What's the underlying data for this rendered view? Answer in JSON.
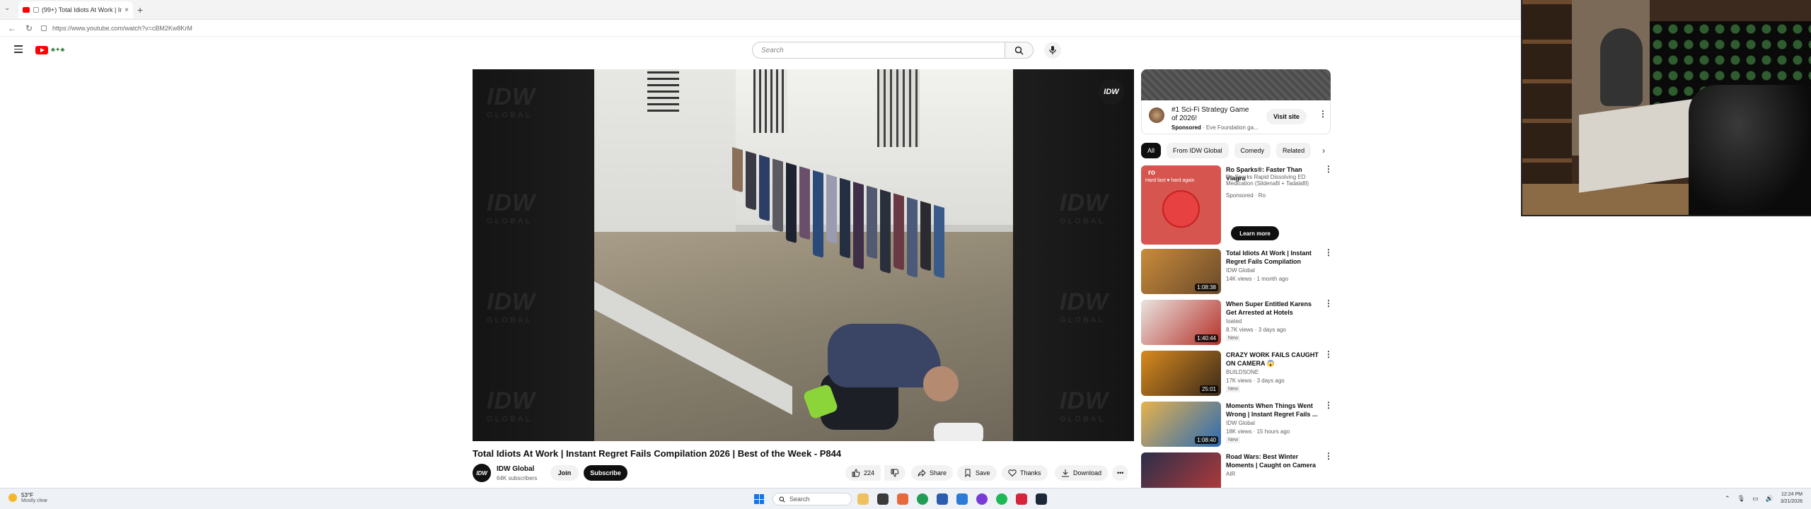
{
  "browser": {
    "tab_title": "(99+) Total Idiots At Work | In...",
    "tab_close": "×",
    "new_tab": "+",
    "url": "https://www.youtube.com/watch?v=cBM2Kw8KrM"
  },
  "header": {
    "search_placeholder": "Search"
  },
  "player": {
    "watermark": "IDW",
    "watermark_sub": "GLOBAL",
    "badge": "IDW"
  },
  "video": {
    "title": "Total Idiots At Work | Instant Regret Fails Compilation 2026 | Best of the Week - P844",
    "channel_name": "IDW Global",
    "channel_avatar": "IDW",
    "subscribers": "64K subscribers",
    "join_label": "Join",
    "subscribe_label": "Subscribe",
    "likes": "224",
    "share_label": "Share",
    "save_label": "Save",
    "thanks_label": "Thanks",
    "download_label": "Download",
    "more_label": "•••"
  },
  "sidebar": {
    "ad": {
      "title": "#1 Sci-Fi Strategy Game of 2026!",
      "sponsored": "Sponsored",
      "advertiser": "· Eve Foundation ga...",
      "visit_label": "Visit site"
    },
    "chips": [
      "All",
      "From IDW Global",
      "Comedy",
      "Related"
    ],
    "chip_next": "›",
    "recommendations": [
      {
        "title": "Ro Sparks®: Faster Than Viagra",
        "line2": "Ro Sparks Rapid Dissolving ED Medication (Sildenafil + Tadalafil)",
        "line3": "Sponsored · Ro",
        "is_ad": true,
        "cta": "Learn more",
        "thumb_text": "ro",
        "thumb_sub": "Hard fast ♥ hard again",
        "thumb_colors": [
          "#d7554f"
        ]
      },
      {
        "title": "Total Idiots At Work | Instant Regret Fails Compilation 2026...",
        "channel": "IDW Global",
        "views": "14K views · 1 month ago",
        "duration": "1:08:38",
        "badge": "",
        "thumb_colors": [
          "#c98b3a",
          "#6a4a2a"
        ]
      },
      {
        "title": "When Super Entitled Karens Get Arrested at Hotels",
        "channel": "Ioated",
        "views": "8.7K views · 3 days ago",
        "duration": "1:40:44",
        "badge": "New",
        "thumb_colors": [
          "#e9e4df",
          "#b6302a"
        ]
      },
      {
        "title": "CRAZY WORK FAILS CAUGHT ON CAMERA 😱",
        "channel": "BUILDSONE",
        "views": "17K views · 3 days ago",
        "duration": "25:01",
        "badge": "New",
        "thumb_colors": [
          "#d98a1e",
          "#3a2a1a"
        ]
      },
      {
        "title": "Moments When Things Went Wrong | Instant Regret Fails ...",
        "channel": "IDW Global",
        "views": "18K views · 15 hours ago",
        "duration": "1:08:40",
        "badge": "New",
        "thumb_colors": [
          "#e7b24c",
          "#2a6bb5"
        ]
      },
      {
        "title": "Road Wars: Best Winter Moments | Caught on Camera ...",
        "channel": "AIR",
        "views": "",
        "duration": "",
        "badge": "",
        "thumb_colors": [
          "#2a2f4a",
          "#b73a3a"
        ]
      }
    ]
  },
  "taskbar": {
    "temperature": "53°F",
    "weather": "Mostly clear",
    "search_label": "Search",
    "time": "12:24 PM",
    "date": "3/21/2026"
  },
  "colors": {
    "youtube_red": "#ff0000",
    "subscribe_bg": "#0f0f0f",
    "chip_active": "#0f0f0f"
  }
}
